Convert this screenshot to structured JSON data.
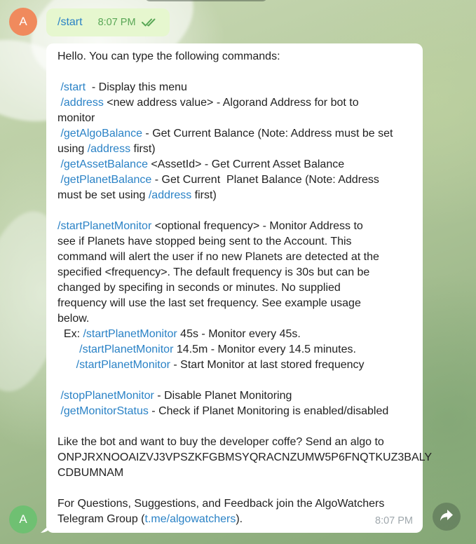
{
  "outgoing": {
    "avatar_letter": "A",
    "command": "/start",
    "time": "8:07 PM",
    "status_icon": "double-check-icon"
  },
  "incoming": {
    "avatar_letter": "A",
    "time": "8:07 PM",
    "intro": "Hello. You can type the following commands:",
    "cmd_start": "/start",
    "cmd_start_desc": "  - Display this menu",
    "cmd_address": "/address",
    "cmd_address_desc": " <new address value> - Algorand Address for bot to",
    "cmd_address_desc2": "monitor",
    "cmd_getalgo": "/getAlgoBalance",
    "cmd_getalgo_desc": " - Get Current Balance (Note: Address must be set",
    "cmd_getalgo_desc2a": "using ",
    "cmd_getalgo_link": "/address",
    "cmd_getalgo_desc2b": " first)",
    "cmd_getasset": "/getAssetBalance",
    "cmd_getasset_desc": " <AssetId> - Get Current Asset Balance",
    "cmd_getplanet": "/getPlanetBalance",
    "cmd_getplanet_desc": " - Get Current  Planet Balance (Note: Address",
    "cmd_getplanet_desc2a": "must be set using ",
    "cmd_getplanet_link": "/address",
    "cmd_getplanet_desc2b": " first)",
    "cmd_startmon": "/startPlanetMonitor",
    "cmd_startmon_desc": " <optional frequency> - Monitor Address to",
    "startmon_lines": [
      "see if Planets have stopped being sent to the Account. This",
      "command will alert the user if no new Planets are detected at the",
      "specified <frequency>. The default frequency is 30s but can be",
      "changed by specifing in seconds or minutes. No supplied",
      "frequency will use the last set frequency. See example usage",
      "below."
    ],
    "ex1_prefix": "  Ex: ",
    "ex1_link": "/startPlanetMonitor",
    "ex1_desc": " 45s - Monitor every 45s.",
    "ex2_prefix": "       ",
    "ex2_link": "/startPlanetMonitor",
    "ex2_desc": " 14.5m - Monitor every 14.5 minutes.",
    "ex3_prefix": "      ",
    "ex3_link": "/startPlanetMonitor",
    "ex3_desc": " - Start Monitor at last stored frequency",
    "cmd_stopmon": "/stopPlanetMonitor",
    "cmd_stopmon_desc": " - Disable Planet Monitoring",
    "cmd_status": "/getMonitorStatus",
    "cmd_status_desc": " - Check if Planet Monitoring is enabled/disabled",
    "coffee_line1": "Like the bot and want to buy the developer coffe? Send an algo to",
    "coffee_line2": "ONPJRXNOOAIZVJ3VPSZKFGBMSYQRACNZUMW5P6FNQTKUZ3BALY",
    "coffee_line3": "CDBUMNAM",
    "feedback_line1": "For Questions, Suggestions, and Feedback join the AlgoWatchers",
    "feedback_line2a": "Telegram Group (",
    "feedback_link": "t.me/algowatchers",
    "feedback_line2b": ")."
  },
  "share_icon": "share-arrow-icon",
  "colors": {
    "link": "#2a82c6",
    "outgoing_bubble": "#e6f7cf",
    "outgoing_time": "#59a756",
    "avatar_top": "#f08a5d",
    "avatar_bottom": "#6fc072"
  }
}
